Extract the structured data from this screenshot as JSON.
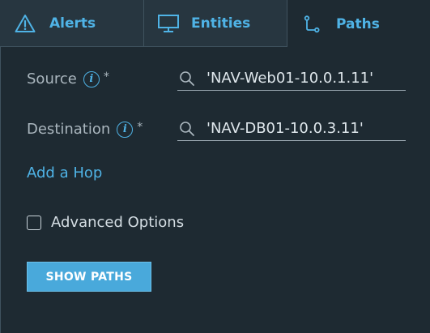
{
  "tabs": [
    {
      "label": "Alerts",
      "icon": "warning-triangle-icon",
      "active": false
    },
    {
      "label": "Entities",
      "icon": "monitor-icon",
      "active": false
    },
    {
      "label": "Paths",
      "icon": "path-icon",
      "active": true
    }
  ],
  "form": {
    "source": {
      "label": "Source",
      "required_mark": "*",
      "value": "'NAV-Web01-10.0.1.11'"
    },
    "destination": {
      "label": "Destination",
      "required_mark": "*",
      "value": "'NAV-DB01-10.0.3.11'"
    },
    "info_glyph": "i",
    "add_hop_label": "Add a Hop",
    "advanced_options_label": "Advanced Options",
    "show_paths_label": "SHOW PATHS"
  },
  "colors": {
    "accent": "#4fb3e6",
    "background": "#1e2a32",
    "tab_bar": "#273640",
    "button": "#49a9db"
  }
}
